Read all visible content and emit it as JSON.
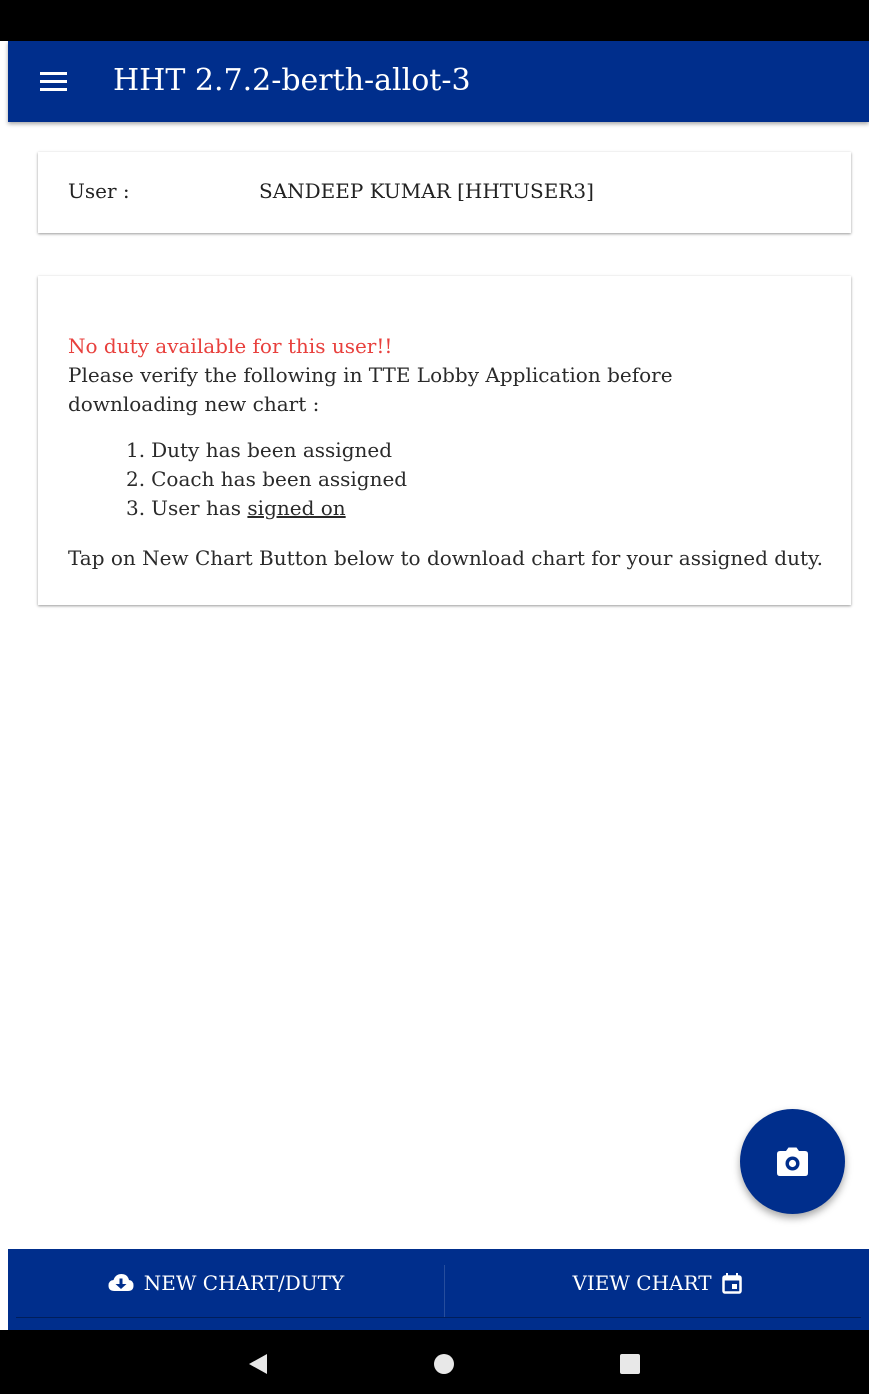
{
  "app_bar": {
    "title": "HHT 2.7.2-berth-allot-3",
    "menu_icon": "hamburger-menu-icon",
    "background_color": "#002e8c"
  },
  "user_card": {
    "label": "User :",
    "value": "SANDEEP KUMAR [HHTUSER3]"
  },
  "info_card": {
    "warning": "No duty available for this user!!",
    "warning_color": "#e8403d",
    "instruction": "Please verify the following in TTE Lobby Application before downloading new chart :",
    "steps": [
      {
        "num": "1.",
        "text": "Duty has been assigned"
      },
      {
        "num": "2.",
        "text": "Coach has been assigned"
      },
      {
        "num": "3.",
        "text": "User has ",
        "underlined": "signed on"
      }
    ],
    "tap_note": "Tap on New Chart Button below to download chart for your assigned duty."
  },
  "fab": {
    "icon": "camera-icon"
  },
  "bottom_bar": {
    "new_chart_label": "NEW CHART/DUTY",
    "new_chart_icon": "cloud-download-icon",
    "view_chart_label": "VIEW CHART",
    "view_chart_icon": "calendar-icon"
  },
  "nav_bar": {
    "back_icon": "back-triangle-icon",
    "home_icon": "home-circle-icon",
    "recents_icon": "recents-square-icon"
  }
}
